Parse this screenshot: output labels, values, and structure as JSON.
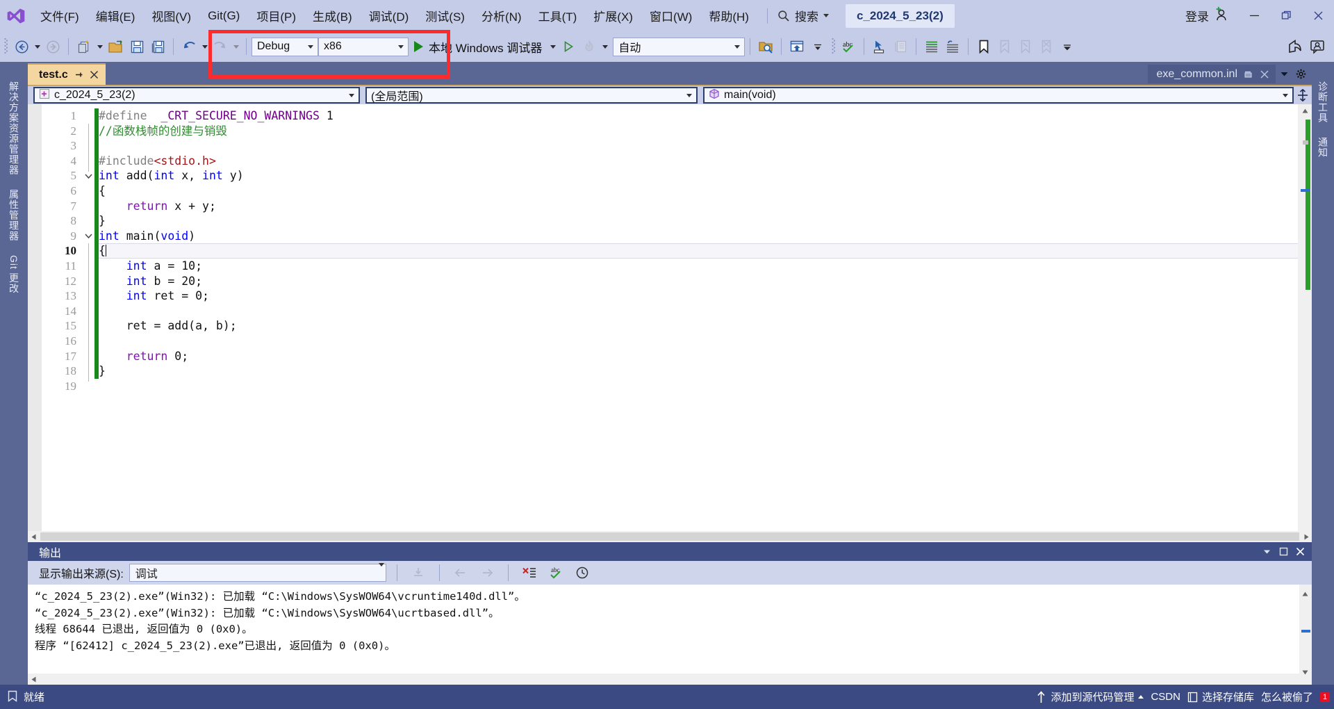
{
  "window": {
    "solution_chip": "c_2024_5_23(2)",
    "sign_in": "登录",
    "minimize_icon": "minimize-icon",
    "restore_icon": "restore-icon",
    "close_icon": "close-icon"
  },
  "menu": {
    "items": [
      {
        "label": "文件(F)",
        "name": "menu-file"
      },
      {
        "label": "编辑(E)",
        "name": "menu-edit"
      },
      {
        "label": "视图(V)",
        "name": "menu-view"
      },
      {
        "label": "Git(G)",
        "name": "menu-git"
      },
      {
        "label": "项目(P)",
        "name": "menu-project"
      },
      {
        "label": "生成(B)",
        "name": "menu-build"
      },
      {
        "label": "调试(D)",
        "name": "menu-debug"
      },
      {
        "label": "测试(S)",
        "name": "menu-test"
      },
      {
        "label": "分析(N)",
        "name": "menu-analyze"
      },
      {
        "label": "工具(T)",
        "name": "menu-tools"
      },
      {
        "label": "扩展(X)",
        "name": "menu-extensions"
      },
      {
        "label": "窗口(W)",
        "name": "menu-window"
      },
      {
        "label": "帮助(H)",
        "name": "menu-help"
      }
    ],
    "search_placeholder": "搜索"
  },
  "toolbar": {
    "configuration": "Debug",
    "platform": "x86",
    "run_label": "本地 Windows 调试器",
    "auto_label": "自动",
    "annotation_color": "#fd2b2b"
  },
  "left_dock": {
    "items": [
      {
        "label": "解决方案资源管理器",
        "name": "dock-solution-explorer"
      },
      {
        "label": "属性管理器",
        "name": "dock-property-manager"
      },
      {
        "label": "Git 更改",
        "name": "dock-git-changes"
      }
    ]
  },
  "right_dock": {
    "items": [
      {
        "label": "诊断工具",
        "name": "dock-diagnostic-tools"
      },
      {
        "label": "通知",
        "name": "dock-notifications"
      }
    ]
  },
  "tabs": {
    "active": "test.c",
    "inactive": "exe_common.inl"
  },
  "navbar": {
    "project": "c_2024_5_23(2)",
    "scope": "(全局范围)",
    "member": "main(void)"
  },
  "editor": {
    "current_line": 10,
    "total_lines": 19,
    "lines": [
      {
        "n": 1,
        "tokens": [
          {
            "t": "#define ",
            "c": "pp"
          },
          {
            "t": " _CRT_SECURE_NO_WARNINGS ",
            "c": "mac"
          },
          {
            "t": "1",
            "c": "num"
          }
        ]
      },
      {
        "n": 2,
        "tokens": [
          {
            "t": "//函数栈帧的创建与销毁",
            "c": "cmt"
          }
        ]
      },
      {
        "n": 3,
        "tokens": []
      },
      {
        "n": 4,
        "tokens": [
          {
            "t": "#include",
            "c": "pp"
          },
          {
            "t": "<stdio.h>",
            "c": "str"
          }
        ]
      },
      {
        "n": 5,
        "tokens": [
          {
            "t": "int",
            "c": "k"
          },
          {
            "t": " add(",
            "c": "pl"
          },
          {
            "t": "int",
            "c": "k"
          },
          {
            "t": " x, ",
            "c": "pl"
          },
          {
            "t": "int",
            "c": "k"
          },
          {
            "t": " y)",
            "c": "pl"
          }
        ]
      },
      {
        "n": 6,
        "tokens": [
          {
            "t": "{",
            "c": "pl"
          }
        ]
      },
      {
        "n": 7,
        "tokens": [
          {
            "t": "    ",
            "c": "pl"
          },
          {
            "t": "return",
            "c": "kw2"
          },
          {
            "t": " x + y;",
            "c": "pl"
          }
        ]
      },
      {
        "n": 8,
        "tokens": [
          {
            "t": "}",
            "c": "pl"
          }
        ]
      },
      {
        "n": 9,
        "tokens": [
          {
            "t": "int",
            "c": "k"
          },
          {
            "t": " main(",
            "c": "pl"
          },
          {
            "t": "void",
            "c": "k"
          },
          {
            "t": ")",
            "c": "pl"
          }
        ]
      },
      {
        "n": 10,
        "tokens": [
          {
            "t": "{",
            "c": "pl"
          }
        ]
      },
      {
        "n": 11,
        "tokens": [
          {
            "t": "    ",
            "c": "pl"
          },
          {
            "t": "int",
            "c": "k"
          },
          {
            "t": " a = ",
            "c": "pl"
          },
          {
            "t": "10",
            "c": "num"
          },
          {
            "t": ";",
            "c": "pl"
          }
        ]
      },
      {
        "n": 12,
        "tokens": [
          {
            "t": "    ",
            "c": "pl"
          },
          {
            "t": "int",
            "c": "k"
          },
          {
            "t": " b = ",
            "c": "pl"
          },
          {
            "t": "20",
            "c": "num"
          },
          {
            "t": ";",
            "c": "pl"
          }
        ]
      },
      {
        "n": 13,
        "tokens": [
          {
            "t": "    ",
            "c": "pl"
          },
          {
            "t": "int",
            "c": "k"
          },
          {
            "t": " ret = ",
            "c": "pl"
          },
          {
            "t": "0",
            "c": "num"
          },
          {
            "t": ";",
            "c": "pl"
          }
        ]
      },
      {
        "n": 14,
        "tokens": []
      },
      {
        "n": 15,
        "tokens": [
          {
            "t": "    ret = add(a, b);",
            "c": "pl"
          }
        ]
      },
      {
        "n": 16,
        "tokens": []
      },
      {
        "n": 17,
        "tokens": [
          {
            "t": "    ",
            "c": "pl"
          },
          {
            "t": "return",
            "c": "kw2"
          },
          {
            "t": " ",
            "c": "pl"
          },
          {
            "t": "0",
            "c": "num"
          },
          {
            "t": ";",
            "c": "pl"
          }
        ]
      },
      {
        "n": 18,
        "tokens": [
          {
            "t": "}",
            "c": "pl"
          }
        ]
      },
      {
        "n": 19,
        "tokens": []
      }
    ]
  },
  "output": {
    "title": "输出",
    "source_label": "显示输出来源(S):",
    "source_value": "调试",
    "lines": [
      "“c_2024_5_23(2).exe”(Win32): 已加载 “C:\\Windows\\SysWOW64\\vcruntime140d.dll”。",
      "“c_2024_5_23(2).exe”(Win32): 已加载 “C:\\Windows\\SysWOW64\\ucrtbased.dll”。",
      "线程 68644 已退出, 返回值为 0 (0x0)。",
      "程序 “[62412] c_2024_5_23(2).exe”已退出, 返回值为 0 (0x0)。"
    ]
  },
  "statusbar": {
    "ready": "就绪",
    "add_to_source_control": "添加到源代码管理",
    "repo": "选择存储库",
    "extra": "怎么被偷了",
    "brand": "CSDN",
    "notification_count": "1"
  }
}
